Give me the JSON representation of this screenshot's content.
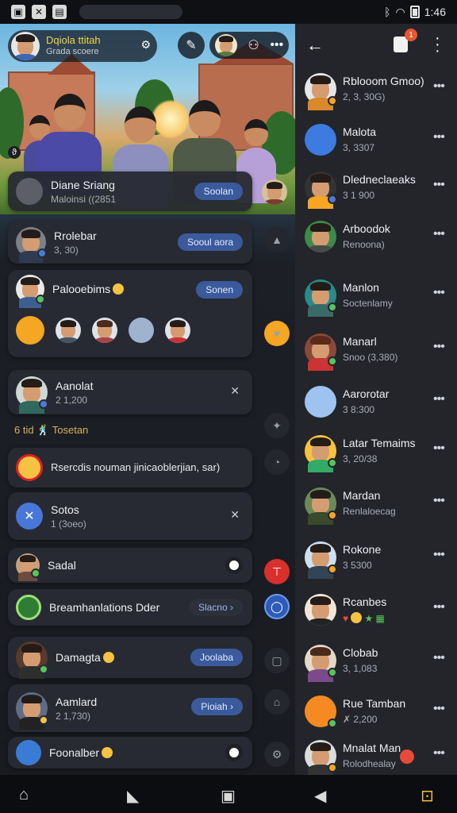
{
  "status_bar": {
    "time": "1:46"
  },
  "left": {
    "profile": {
      "name": "Dqiola ttitah",
      "subtitle": "Grada scoere"
    },
    "cards": {
      "c1": {
        "title": "Diane Sriang",
        "subtitle": "Maloinsi ((2851",
        "button": "Soolan"
      },
      "c2": {
        "title": "Rrolebar",
        "subtitle": "3, 30)",
        "button": "Sooul aora"
      },
      "c3": {
        "title": "Palooebims",
        "button": "Sonen"
      },
      "c4": {
        "title": "Aanolat",
        "subtitle": "2 1,200"
      },
      "c5_line": "6 tid 🕺 Tosetan",
      "c6": {
        "text": "Rsercdis nouman jinicaoblerjian, sar)"
      },
      "c7": {
        "title": "Sotos",
        "subtitle": "1 (3oeo)"
      },
      "c8": {
        "title": "Sadal"
      },
      "c9": {
        "title": "Breamhanlations Dder",
        "button": "Slacno"
      },
      "c10": {
        "title": "Damagta",
        "button": "Joolaba"
      },
      "c11": {
        "title": "Aamlard",
        "subtitle": "2 1,730)",
        "button": "Pioiah"
      },
      "c12": {
        "title": "Foonalber"
      }
    }
  },
  "right": {
    "items": [
      {
        "name": "Rblooom Gmoo)",
        "sub": "2, 3, 30G)"
      },
      {
        "name": "Malota",
        "sub": "3, 3307"
      },
      {
        "name": "Dledneclaeaks",
        "sub": "3 1 900"
      },
      {
        "name": "Arboodok",
        "sub": "Renoona)"
      },
      {
        "name": "Manlon",
        "sub": "Soctenlamy"
      },
      {
        "name": "Manarl",
        "sub": "Snoo (3,380)"
      },
      {
        "name": "Aarorotar",
        "sub": "3 8:300"
      },
      {
        "name": "Latar Temaims",
        "sub": "3, 20/38"
      },
      {
        "name": "Mardan",
        "sub": "Renlaloecag"
      },
      {
        "name": "Rokone",
        "sub": "3 5300"
      },
      {
        "name": "Rcanbes",
        "sub": ""
      },
      {
        "name": "Clobab",
        "sub": "3, 1,083"
      },
      {
        "name": "Rue Tamban",
        "sub": "✗ 2,200"
      },
      {
        "name": "Mnalat Man",
        "sub": "Rolodhealay"
      }
    ]
  },
  "colors": {
    "accent": "#3a5a9c",
    "notification": "#e8572e",
    "online": "#58c45b"
  }
}
